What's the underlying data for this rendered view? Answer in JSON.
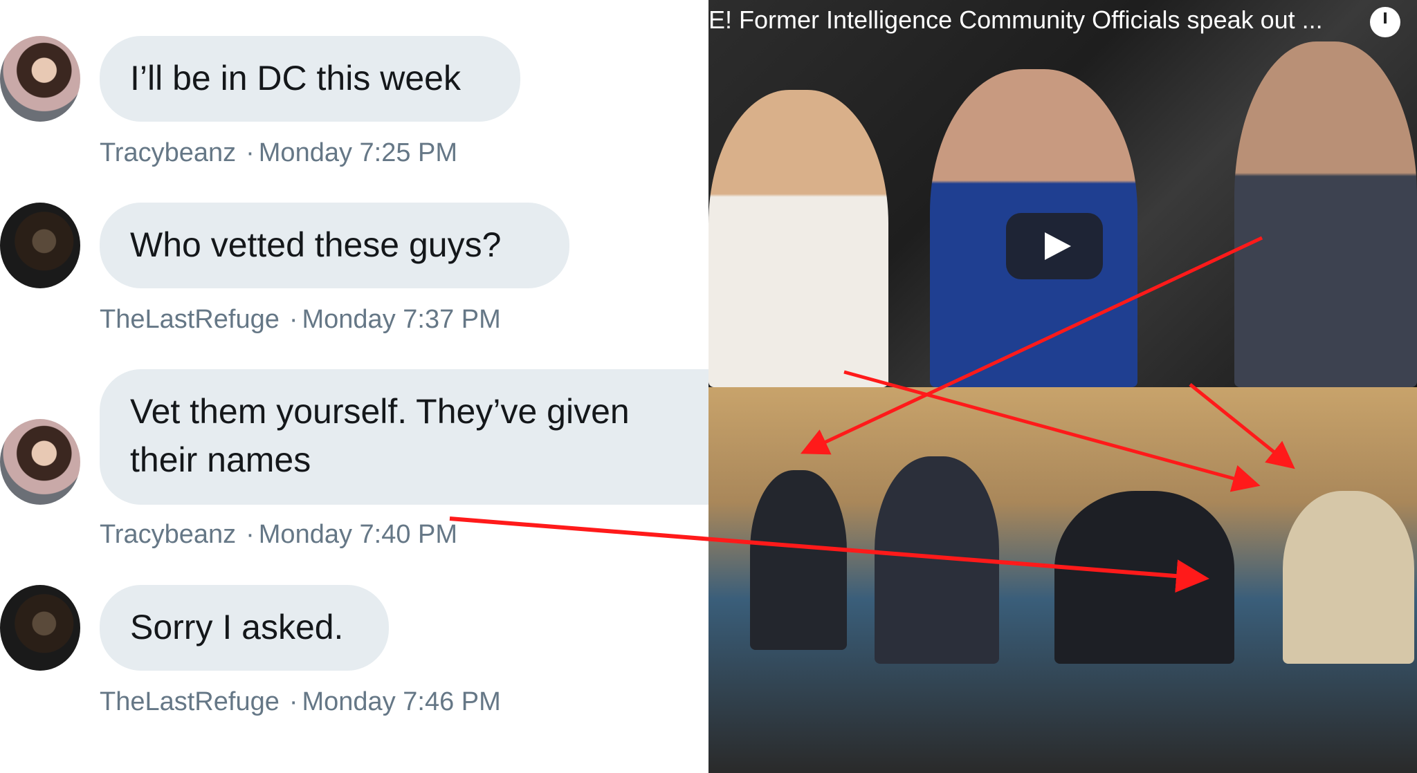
{
  "messages": [
    {
      "text": "I’ll be in DC this week",
      "author": "Tracybeanz",
      "time": "Monday 7:25 PM",
      "avatar": "tracybeanz-avatar"
    },
    {
      "text": "Who vetted these guys?",
      "author": "TheLastRefuge",
      "time": "Monday 7:37 PM",
      "avatar": "thelastrefuge-avatar"
    },
    {
      "text": "Vet them yourself. They’ve given their names",
      "author": "Tracybeanz",
      "time": "Monday 7:40 PM",
      "avatar": "tracybeanz-avatar"
    },
    {
      "text": "Sorry I asked.",
      "author": "TheLastRefuge",
      "time": "Monday 7:46 PM",
      "avatar": "thelastrefuge-avatar"
    }
  ],
  "video": {
    "title": "E! Former Intelligence Community Officials speak out ...",
    "icons": [
      "clock-icon",
      "play-icon"
    ]
  },
  "colors": {
    "bubble": "#e6ecf0",
    "meta": "#657786",
    "arrow": "#ff1a1a"
  }
}
